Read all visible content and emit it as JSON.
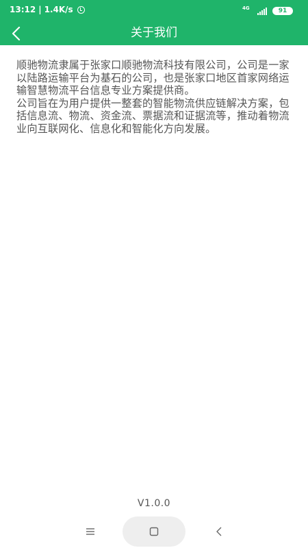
{
  "status_bar": {
    "time": "13:12",
    "separator": "|",
    "speed": "1.4K/s",
    "network_type": "4G",
    "battery": "91",
    "alarm_icon": "alarm-clock-icon"
  },
  "header": {
    "title": "关于我们",
    "back_icon": "chevron-left-icon",
    "color": "#1fb46a"
  },
  "content": {
    "paragraphs": [
      "顺驰物流隶属于张家口顺驰物流科技有限公司，公司是一家以陆路运输平台为基石的公司，也是张家口地区首家网络运输智慧物流平台信息专业方案提供商。",
      "公司旨在为用户提供一整套的智能物流供应链解决方案，包括信息流、物流、资金流、票据流和证据流等，推动着物流业向互联网化、信息化和智能化方向发展。"
    ]
  },
  "footer": {
    "version": "V1.0.0"
  },
  "nav_bar": {
    "menu_icon": "menu-icon",
    "home_icon": "square-home-icon",
    "back_icon": "triangle-back-icon"
  }
}
